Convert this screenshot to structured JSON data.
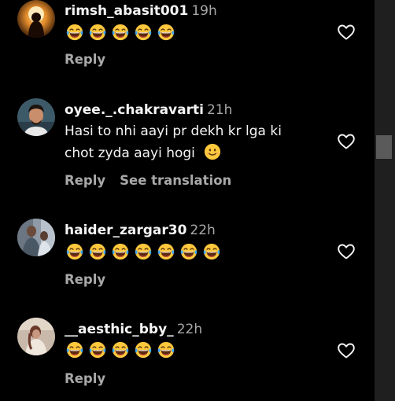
{
  "comments": [
    {
      "username": "rimsh_abasit001",
      "time": "19h",
      "laugh_count": 5,
      "reply_label": "Reply"
    },
    {
      "username": "oyee._.chakravarti",
      "time": "21h",
      "text_line1": "Hasi to nhi aayi pr dekh kr lga ki",
      "text_line2": "chot zyda aayi hogi",
      "emoji": "smiling-face-emoji",
      "reply_label": "Reply",
      "translate_label": "See translation"
    },
    {
      "username": "haider_zargar30",
      "time": "22h",
      "laugh_count": 7,
      "reply_label": "Reply"
    },
    {
      "username": "__aesthic_bby_",
      "time": "22h",
      "laugh_count": 5,
      "reply_label": "Reply"
    }
  ],
  "icons": {
    "like": "heart-outline-icon",
    "laugh": "face-with-tears-of-joy-emoji"
  },
  "colors": {
    "background": "#000000",
    "primary_text": "#f5f5f5",
    "secondary_text": "#a8a8a8",
    "emoji_yellow": "#ffc83d"
  }
}
